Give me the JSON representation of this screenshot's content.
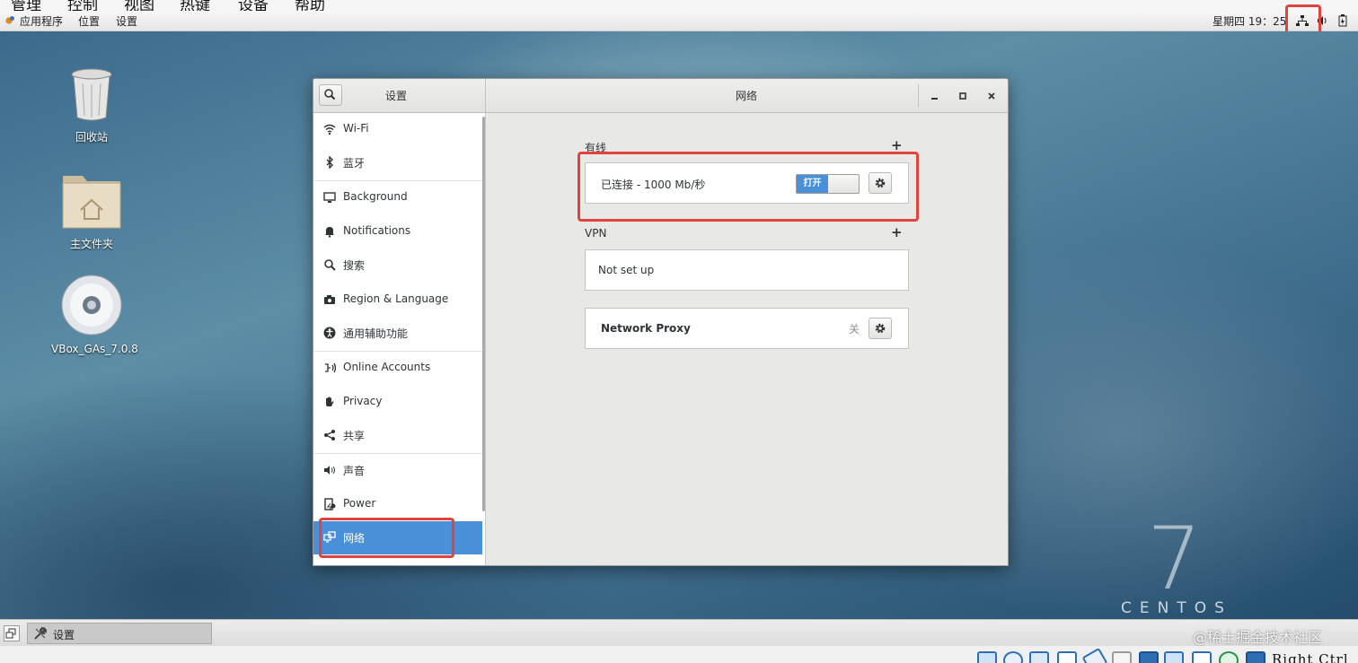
{
  "vbox_menu": {
    "items": [
      "管理",
      "控制",
      "视图",
      "热键",
      "设备",
      "帮助"
    ]
  },
  "top_panel": {
    "applications": "应用程序",
    "places": "位置",
    "settings": "设置",
    "clock": "星期四 19：25",
    "tray_icons": [
      "network-wired-icon",
      "volume-icon",
      "battery-icon"
    ]
  },
  "desktop": {
    "icons": [
      {
        "label": "回收站",
        "icon": "trash-icon"
      },
      {
        "label": "主文件夹",
        "icon": "home-folder-icon"
      },
      {
        "label": "VBox_GAs_7.0.8",
        "icon": "disc-icon"
      }
    ],
    "branding_number": "7",
    "branding_word": "CENTOS"
  },
  "settings_window": {
    "sidebar_title": "设置",
    "panel_title": "网络",
    "sidebar": [
      {
        "label": "Wi-Fi",
        "icon": "wifi-icon"
      },
      {
        "label": "蓝牙",
        "icon": "bluetooth-icon"
      },
      {
        "label": "Background",
        "icon": "background-icon"
      },
      {
        "label": "Notifications",
        "icon": "bell-icon"
      },
      {
        "label": "搜索",
        "icon": "search-icon"
      },
      {
        "label": "Region & Language",
        "icon": "camera-icon"
      },
      {
        "label": "通用辅助功能",
        "icon": "accessibility-icon"
      },
      {
        "label": "Online Accounts",
        "icon": "online-accounts-icon"
      },
      {
        "label": "Privacy",
        "icon": "hand-icon"
      },
      {
        "label": "共享",
        "icon": "share-icon"
      },
      {
        "label": "声音",
        "icon": "speaker-icon"
      },
      {
        "label": "Power",
        "icon": "power-icon"
      },
      {
        "label": "网络",
        "icon": "network-icon",
        "active": true
      }
    ],
    "wired": {
      "title": "有线",
      "status": "已连接 - 1000 Mb/秒",
      "switch_label": "打开",
      "switch_on": true
    },
    "vpn": {
      "title": "VPN",
      "status": "Not set up"
    },
    "proxy": {
      "label": "Network Proxy",
      "status": "关"
    }
  },
  "taskbar": {
    "task_label": "设置"
  },
  "vbox_status": {
    "host_key": "Right Ctrl"
  },
  "watermark": "@稀土掘金技术社区",
  "colors": {
    "accent": "#4a90d9",
    "annotation": "#e0423c"
  }
}
